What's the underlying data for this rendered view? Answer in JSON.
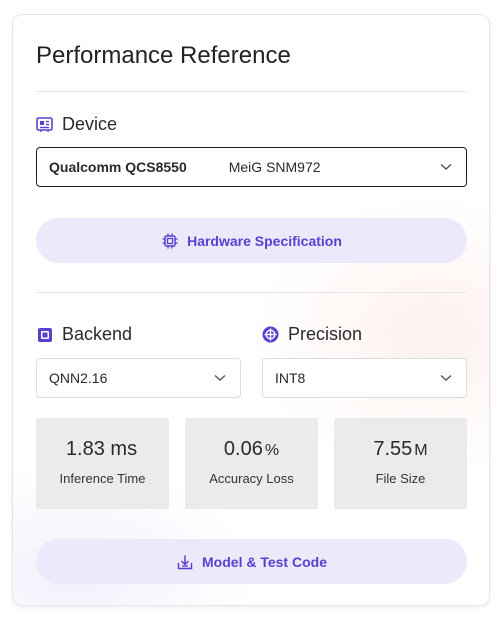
{
  "panel": {
    "title": "Performance Reference"
  },
  "device": {
    "label": "Device",
    "chip": "Qualcomm QCS8550",
    "model": "MeiG SNM972",
    "icon": "chip-board-icon"
  },
  "hardware_button": {
    "label": "Hardware Specification",
    "icon": "cpu-icon"
  },
  "backend": {
    "label": "Backend",
    "value": "QNN2.16",
    "icon": "backend-icon"
  },
  "precision": {
    "label": "Precision",
    "value": "INT8",
    "icon": "target-icon"
  },
  "metrics": [
    {
      "value": "1.83 ms",
      "unit": "",
      "label": "Inference Time"
    },
    {
      "value": "0.06",
      "unit": "%",
      "label": "Accuracy Loss"
    },
    {
      "value": "7.55",
      "unit": "M",
      "label": "File Size"
    }
  ],
  "code_button": {
    "label": "Model & Test Code",
    "icon": "download-icon"
  },
  "colors": {
    "accent": "#5b3fd1",
    "pill_bg": "#ece9fb",
    "metric_bg": "#ebebeb"
  }
}
